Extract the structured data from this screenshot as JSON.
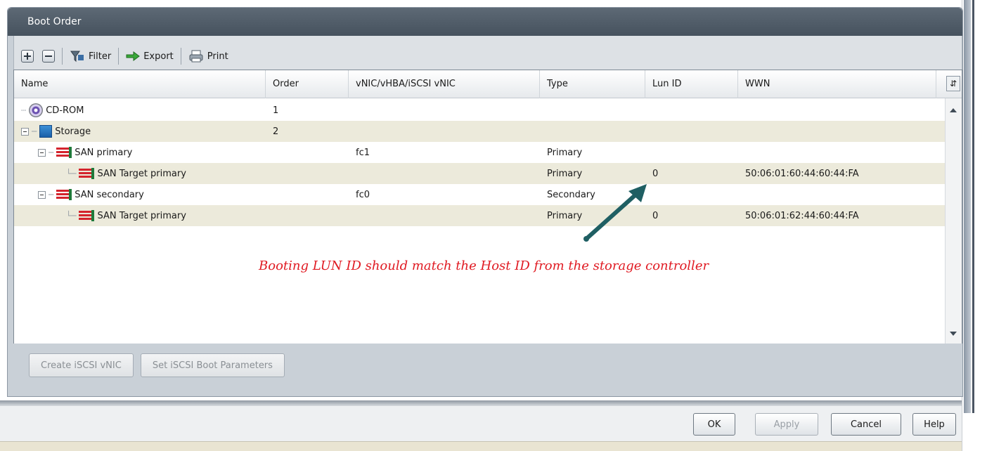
{
  "panel": {
    "title": "Boot Order"
  },
  "toolbar": {
    "expand_icon": "plus-box-icon",
    "collapse_icon": "minus-box-icon",
    "filter_label": "Filter",
    "export_label": "Export",
    "print_label": "Print"
  },
  "table": {
    "columns": [
      "Name",
      "Order",
      "vNIC/vHBA/iSCSI vNIC",
      "Type",
      "Lun ID",
      "WWN"
    ],
    "rows": [
      {
        "name": "CD-ROM",
        "order": "1",
        "vnic": "",
        "type": "",
        "lun": "",
        "wwn": "",
        "icon": "cd-rom-icon",
        "level": 0
      },
      {
        "name": "Storage",
        "order": "2",
        "vnic": "",
        "type": "",
        "lun": "",
        "wwn": "",
        "icon": "storage-icon",
        "level": 0
      },
      {
        "name": "SAN primary",
        "order": "",
        "vnic": "fc1",
        "type": "Primary",
        "lun": "",
        "wwn": "",
        "icon": "san-icon",
        "level": 1
      },
      {
        "name": "SAN Target primary",
        "order": "",
        "vnic": "",
        "type": "Primary",
        "lun": "0",
        "wwn": "50:06:01:60:44:60:44:FA",
        "icon": "san-icon",
        "level": 2
      },
      {
        "name": "SAN secondary",
        "order": "",
        "vnic": "fc0",
        "type": "Secondary",
        "lun": "",
        "wwn": "",
        "icon": "san-icon",
        "level": 1
      },
      {
        "name": "SAN Target primary",
        "order": "",
        "vnic": "",
        "type": "Primary",
        "lun": "0",
        "wwn": "50:06:01:62:44:60:44:FA",
        "icon": "san-icon",
        "level": 2
      }
    ]
  },
  "annotation": {
    "text": "Booting LUN ID should match the Host ID from the storage controller",
    "color": "#e01a22",
    "arrow_color": "#1f5f63"
  },
  "panel_actions": {
    "create_iscsi": "Create iSCSI vNIC",
    "set_iscsi_boot": "Set iSCSI Boot Parameters"
  },
  "dialog_buttons": {
    "ok": "OK",
    "apply": "Apply",
    "cancel": "Cancel",
    "help": "Help"
  },
  "colors": {
    "title_bar": "#4f5b67",
    "alt_row": "#eceadb"
  }
}
